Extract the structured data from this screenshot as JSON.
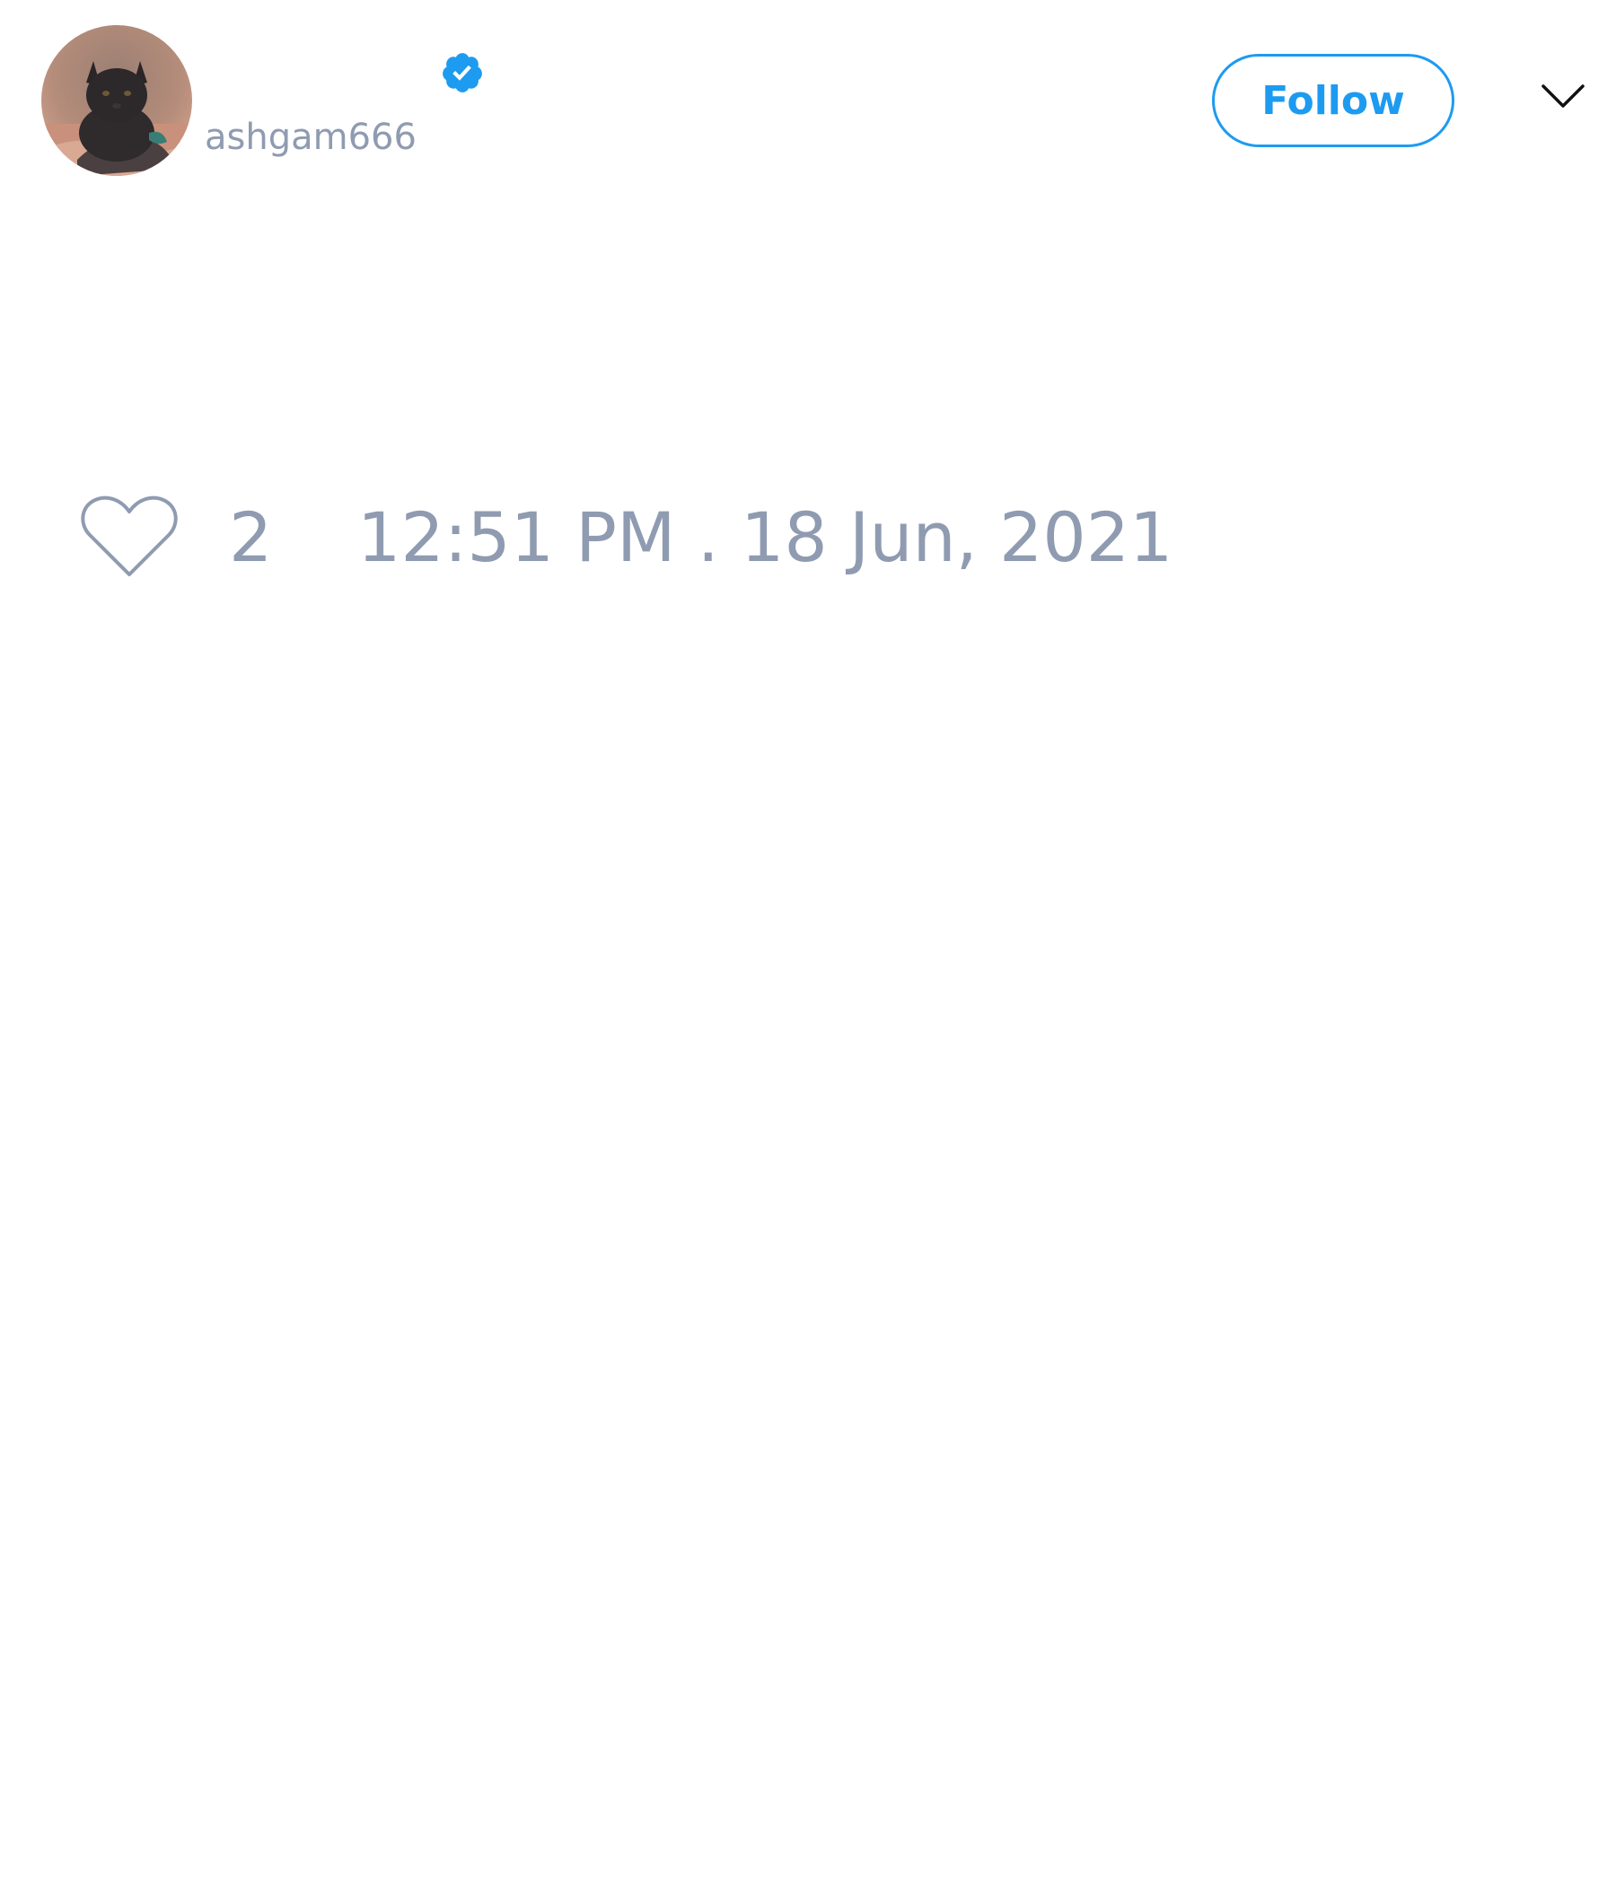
{
  "author": {
    "handle": "ashgam666",
    "verified": true,
    "avatar_icon": "cat-photo-avatar"
  },
  "header": {
    "follow_label": "Follow",
    "menu_icon": "chevron-down-icon"
  },
  "tweet": {
    "like_icon": "heart-outline-icon",
    "like_count": "2",
    "timestamp": "12:51 PM . 18 Jun, 2021"
  },
  "colors": {
    "accent": "#1d9bf0",
    "muted_text": "#8f9bb0",
    "background": "#ffffff"
  }
}
